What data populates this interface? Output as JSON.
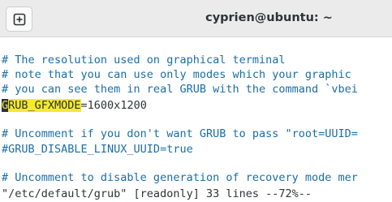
{
  "window": {
    "title": "cyprien@ubuntu: ~"
  },
  "toolbar": {
    "new_tab_icon": "new-tab-icon"
  },
  "editor": {
    "lines": [
      {
        "kind": "comment",
        "text": "# The resolution used on graphical terminal"
      },
      {
        "kind": "comment",
        "text": "# note that you can use only modes which your graphic"
      },
      {
        "kind": "comment",
        "text": "# you can see them in real GRUB with the command `vbei"
      },
      {
        "kind": "setting",
        "cursor_char": "G",
        "highlight": "RUB_GFXMODE",
        "rest": "=1600x1200"
      },
      {
        "kind": "blank",
        "text": ""
      },
      {
        "kind": "comment",
        "text": "# Uncomment if you don't want GRUB to pass \"root=UUID="
      },
      {
        "kind": "comment",
        "text": "#GRUB_DISABLE_LINUX_UUID=true"
      },
      {
        "kind": "blank",
        "text": ""
      },
      {
        "kind": "comment",
        "text": "# Uncomment to disable generation of recovery mode mer"
      }
    ],
    "status_line": "\"/etc/default/grub\" [readonly] 33 lines --72%--"
  },
  "colors": {
    "comment": "#1a6ea8",
    "highlight": "#f5e930",
    "text": "#2e3436",
    "titlebar": "#ebebeb"
  }
}
